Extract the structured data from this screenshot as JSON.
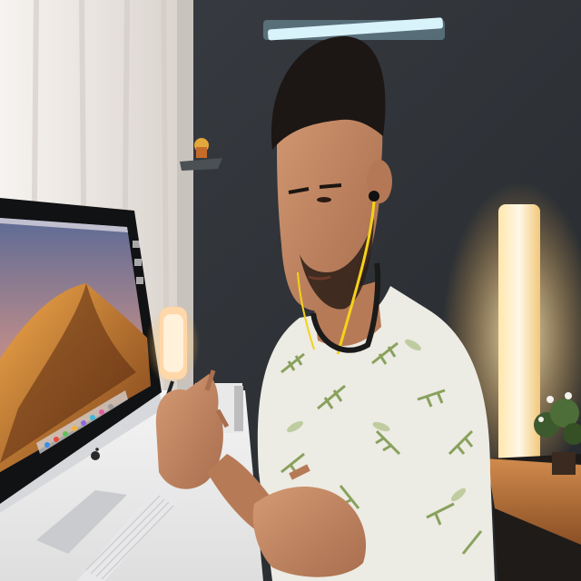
{
  "scene": {
    "description_colors": {
      "wall": "#2f3338",
      "curtain": "#eeeae6",
      "lamp_glow": "#ffd88a",
      "shelf_wood": "#b8743e",
      "earphone_cable": "#f5d21a",
      "shirt": "#ecebe4",
      "leaf_pattern": "#7f9a4e",
      "skin": "#c98f6a",
      "hair": "#1c1714",
      "imac_silver": "#d9dbde",
      "desktop_dune": "#c9822e",
      "desktop_sky": "#6a6f8c"
    },
    "icons": [
      "apple-logo-icon",
      "dock-icons",
      "ceiling-led-strip-icon",
      "floor-lamp-icon",
      "potted-plant-icon"
    ]
  }
}
